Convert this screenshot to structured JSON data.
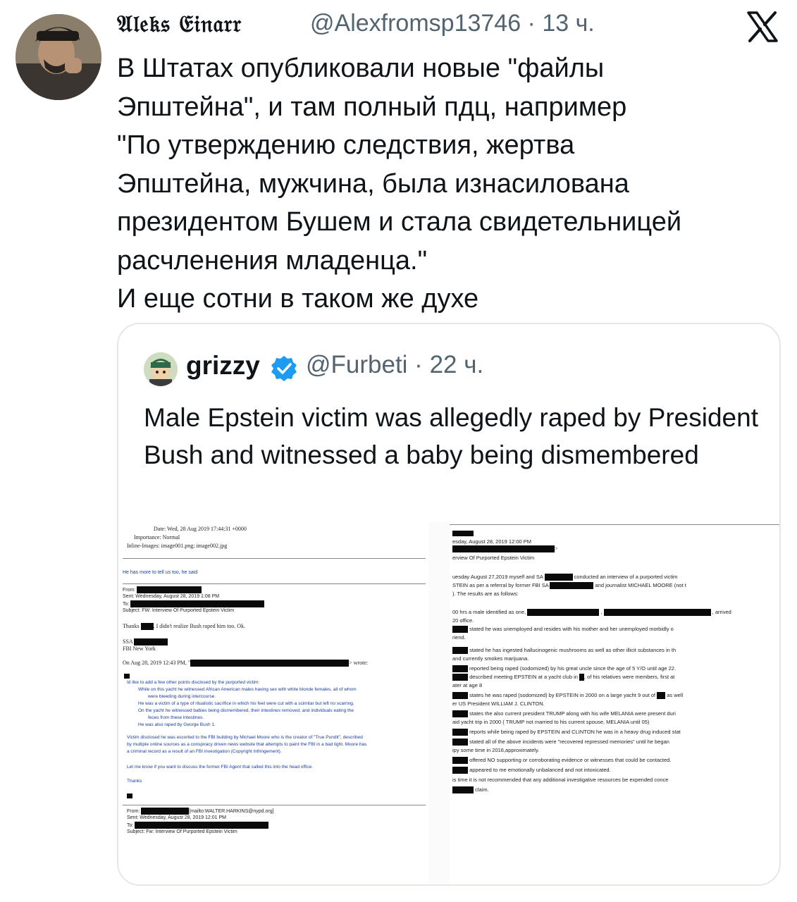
{
  "tweet": {
    "author_name": "𝔄𝔩𝔢𝔨𝔰 𝔈𝔦𝔫𝔞𝔯𝔯",
    "handle_time": "@Alexfromsp13746 · 13 ч.",
    "body": "В Штатах опубликовали новые \"файлы\nЭпштейна\", и там полный пдц, например\n\"По утверждению следствия, жертва\nЭпштейна, мужчина, была изнасилована\nпрезидентом Бушем и стала свидетельницей\nрасчленения младенца.\"\nИ еще сотни в таком же духе"
  },
  "quote": {
    "name": "grizzy",
    "handle_time": "@Furbeti · 22 ч.",
    "text": "Male Epstein victim was allegedly raped by President Bush and witnessed a baby being dismembered"
  },
  "doc_left": {
    "date": "Date: Wed, 28 Aug 2019 17:44:31 +0000",
    "importance": "Importance: Normal",
    "inline": "Inline-Images: image001.png; image002.jpg",
    "told": "He has more to tell us too, he said",
    "from": "From:",
    "sent": "Sent: Wednesday, August 28, 2019 1:08 PM",
    "to": "To:",
    "subject": "Subject: FW: Interview Of Purported Epstein Victim",
    "thanks_pre": "Thanks",
    "thanks_post": ". I didn't realize Bush raped him too. Ok.",
    "ssa": "SSA",
    "fbi": "FBI New York",
    "on_date": "On Aug 28, 2019 12:43 PM, \"",
    "wrote": "> wrote:",
    "b1": "Id like to add a few other points disclosed by the purported victim:",
    "b2": "While on this yacht he witnessed African American males having sex with white blonde females, all of whom",
    "b3": "were bleeding during intercourse.",
    "b4": "He was a victim of a type of ritualistic sacrifice in which his feet were cut with a scimitar but left no scarring.",
    "b5": "On the yacht he witnessed babies being dismembered, their intestines removed, and individuals eating the",
    "b6": "feces from these intestines.",
    "b7": "He was also raped by George Bush 1.",
    "p1": "Victim disclosed he was escorted to the FBI building by Michael Moore who is the creator of \"True Pundit\", described",
    "p2": "by multiple online sources as a conspiracy driven news website that attempts to paint the FBI in a bad light. Moore has",
    "p3": "a criminal record as a result of an FBI investigation (Copyright Infringement).",
    "p4": "Let me know if you want to discuss the former FBI Agent that called this into the head office.",
    "thanks2": "Thanks",
    "from2": "From:",
    "mailto": "[mailto:WALTER.HARKINS@nypd.org]",
    "sent2": "Sent: Wednesday, August 28, 2019 12:01 PM",
    "to2": "To:",
    "subject2": "Subject: Fw: Interview Of Purported Epstein Victim"
  },
  "doc_right": {
    "l1": "esday, August 28, 2019 12:00 PM",
    "l2": "erview Of Purported Epstein Victim",
    "l3a": "uesday August 27,2019 myself and SA",
    "l3b": "conducted an interview of a purported victim",
    "l4a": "STEIN as per a referral by former  FBI SA",
    "l4b": "and journalist MICHAEL MOORE (not t",
    "l5": "). The results are as follows:",
    "l6a": "00 hrs a male identified as one,",
    "l6b": "arrived",
    "l7": "20 office.",
    "l8": "stated he was unemployed and resides with his mother and her unemployed morbidly o",
    "l9": "riend.",
    "l10": "stated he has ingested hallucinogenic mushrooms as well as other illicit substances in th",
    "l11": "and currently smokes marijuana.",
    "l12": "reported being raped (sodomized) by his great uncle since the age of 5 Y/O until age 22.",
    "l13a": "described meeting EPSTEIN at a yacht club in",
    "l13b": ", of his relatives were members, first at",
    "l14": "ater at age 8",
    "l15a": "states he was raped (sodomized) by EPSTEIN in 2000 on a large yacht 9 out of",
    "l15b": "as well",
    "l16": "er US President WILLIAM J. CLINTON.",
    "l17": "states the also current president TRUMP along with his wife MELANIA were present duri",
    "l18": "aid yacht trip in 2000 ( TRUMP not married to his current spouse, MELANIA until 05)",
    "l19": "reports while being raped by EPSTEIN and CLINTON he was in a heavy drug induced stat",
    "l20": "stated all of the above incidents were \"recovered repressed memories\" until he began",
    "l21": "ipy some time in 2016,approximately.",
    "l22": "offered NO supporting or corroborating evidence or witnesses that could be contacted.",
    "l23": "appeared to me emotionally unbalanced and not intoxicated.",
    "l24": "is time it is not recommended that any additional investigative resources be expended conce",
    "l25": "claim."
  }
}
